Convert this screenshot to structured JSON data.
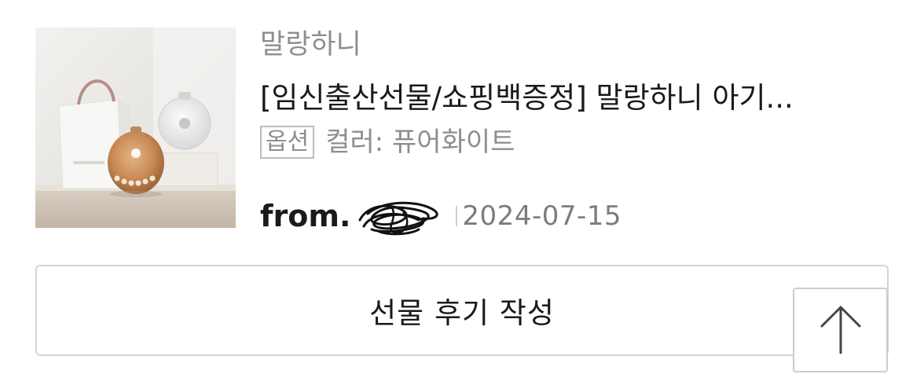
{
  "product": {
    "image_icon": "product-photo-sound-machine",
    "brand": "말랑하니",
    "title": "[임신출산선물/쇼핑백증정] 말랑하니 아기...",
    "option_tag": "옵션",
    "option_text": "컬러: 퓨어화이트"
  },
  "meta": {
    "from_label": "from.",
    "sender_redacted": true,
    "date": "2024-07-15"
  },
  "actions": {
    "write_review_label": "선물 후기 작성",
    "scroll_top_icon": "arrow-up-icon"
  }
}
